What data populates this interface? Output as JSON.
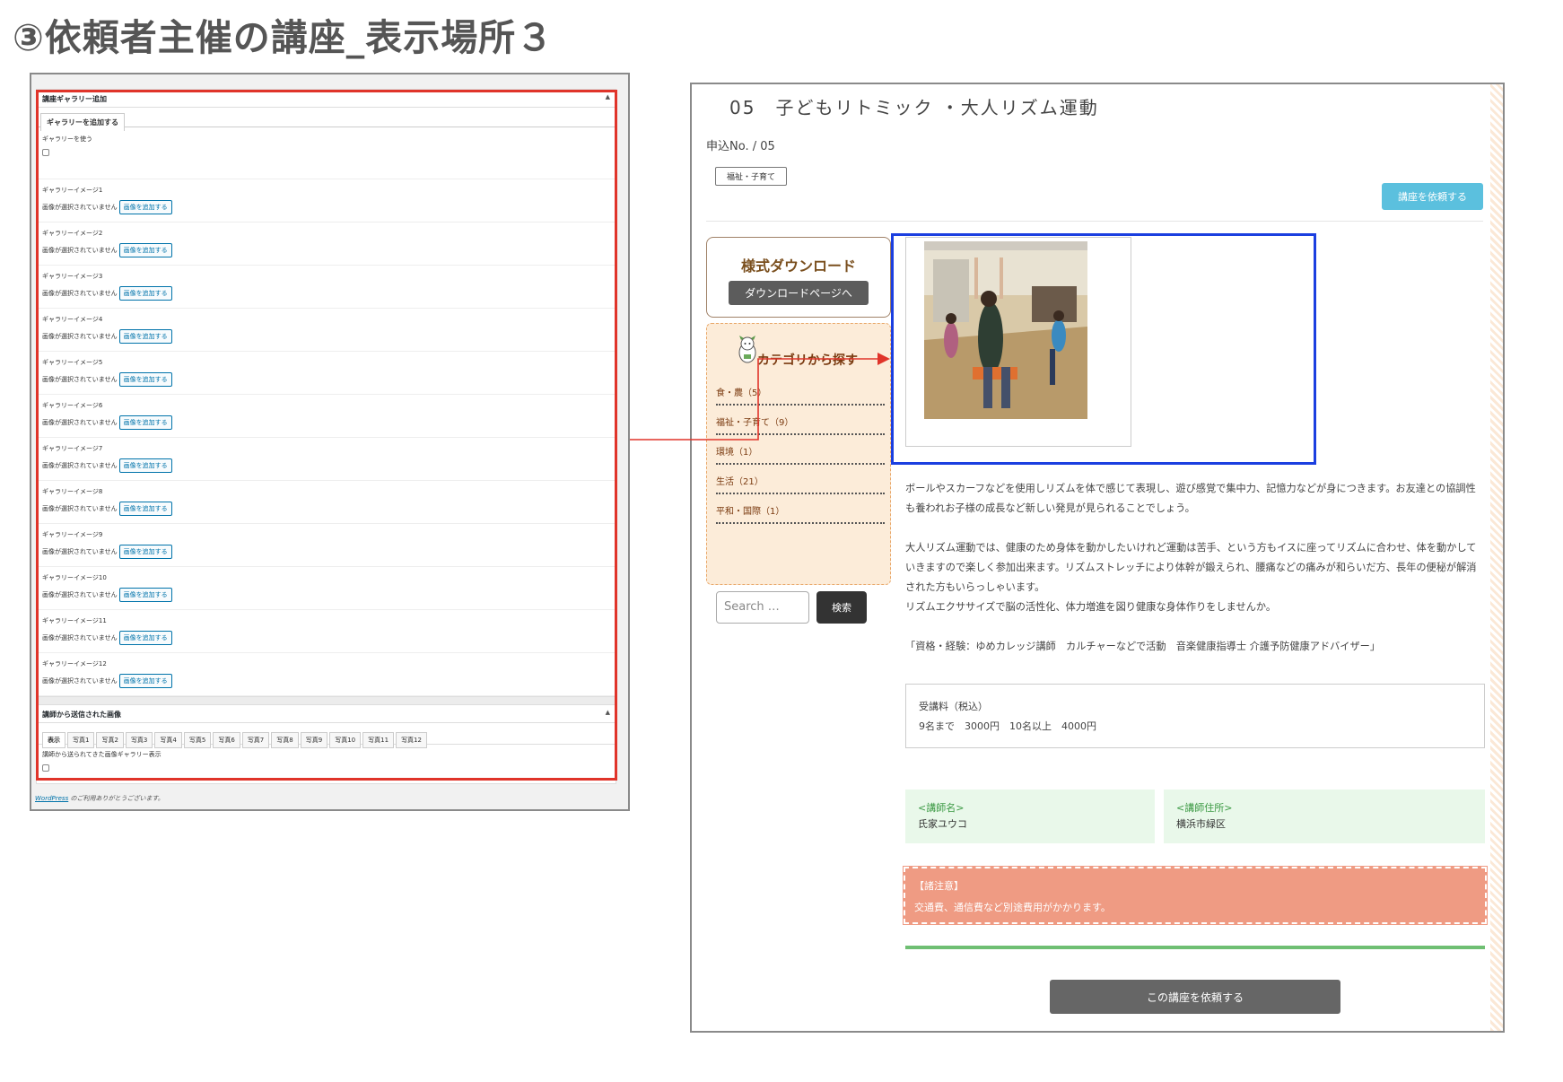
{
  "heading": "③依頼者主催の講座_表示場所３",
  "admin": {
    "gallery_section_title": "講座ギャラリー追加",
    "gallery_tab": "ギャラリーを追加する",
    "use_gallery_label": "ギャラリーを使う",
    "no_image_text": "画像が選択されていません",
    "add_image_button": "画像を追加する",
    "images": [
      {
        "label": "ギャラリーイメージ1"
      },
      {
        "label": "ギャラリーイメージ2"
      },
      {
        "label": "ギャラリーイメージ3"
      },
      {
        "label": "ギャラリーイメージ4"
      },
      {
        "label": "ギャラリーイメージ5"
      },
      {
        "label": "ギャラリーイメージ6"
      },
      {
        "label": "ギャラリーイメージ7"
      },
      {
        "label": "ギャラリーイメージ8"
      },
      {
        "label": "ギャラリーイメージ9"
      },
      {
        "label": "ギャラリーイメージ10"
      },
      {
        "label": "ギャラリーイメージ11"
      },
      {
        "label": "ギャラリーイメージ12"
      }
    ],
    "instructor_section_title": "講師から送信された画像",
    "photo_tabs": [
      "表示",
      "写真1",
      "写真2",
      "写真3",
      "写真4",
      "写真5",
      "写真6",
      "写真7",
      "写真8",
      "写真9",
      "写真10",
      "写真11",
      "写真12"
    ],
    "instructor_display_label": "講師から送られてきた画像ギャラリー表示",
    "footer_link": "WordPress",
    "footer_text": " のご利用ありがとうございます。"
  },
  "page": {
    "title": "05　子どもリトミック ・大人リズム運動",
    "app_no": "申込No. / 05",
    "tag": "福祉・子育て",
    "request_top_button": "講座を依頼する",
    "download": {
      "title": "様式ダウンロード",
      "button": "ダウンロードページへ"
    },
    "category": {
      "heading": "カテゴリから探す",
      "items": [
        "食・農（5）",
        "福祉・子育て（9）",
        "環境（1）",
        "生活（21）",
        "平和・国際（1）"
      ]
    },
    "search": {
      "placeholder": "Search …",
      "button": "検索"
    },
    "desc": {
      "p1": "ボールやスカーフなどを使用しリズムを体で感じて表現し、遊び感覚で集中力、記憶力などが身につきます。お友達との協調性も養われお子様の成長など新しい発見が見られることでしょう。",
      "p2a": "大人リズム運動では、健康のため身体を動かしたいけれど運動は苦手、という方もイスに座ってリズムに合わせ、体を動かしていきますので楽しく参加出来ます。リズムストレッチにより体幹が鍛えられ、腰痛などの痛みが和らいだ方、長年の便秘が解消された方もいらっしゃいます。",
      "p2b": "リズムエクササイズで脳の活性化、体力増進を図り健康な身体作りをしませんか。",
      "p3": "「資格・経験：ゆめカレッジ講師　カルチャーなどで活動　音楽健康指導士 介護予防健康アドバイザー」"
    },
    "fee": {
      "label": "受講料（税込）",
      "value": "9名まで　3000円　10名以上　4000円"
    },
    "instructor_name": {
      "label": "<講師名>",
      "value": "氏家ユウコ"
    },
    "instructor_address": {
      "label": "<講師住所>",
      "value": "横浜市緑区"
    },
    "notice": {
      "label": "【諸注意】",
      "text": "交通費、通信費など別途費用がかかります。"
    },
    "request_bottom_button": "この講座を依頼する"
  },
  "colors": {
    "red_frame": "#e0342a",
    "blue_frame": "#1b3fe0",
    "accent_blue": "#5bc0de",
    "category_bg": "#fcecd9",
    "notice_bg": "#ef9b83",
    "green_rule": "#6fbf73"
  }
}
